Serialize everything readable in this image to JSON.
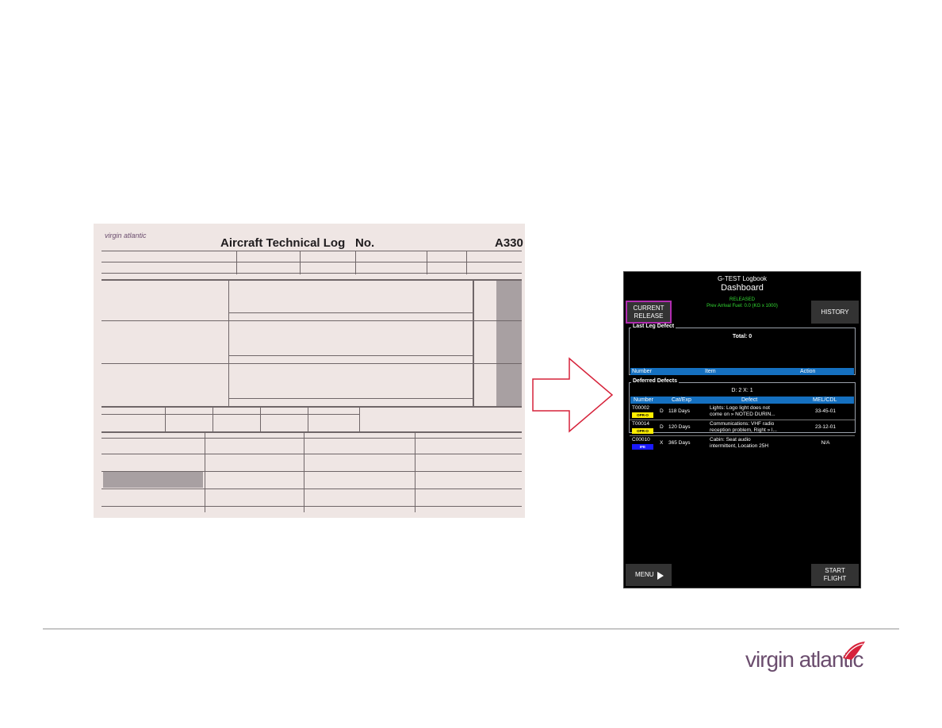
{
  "paper_form": {
    "brand": "virgin atlantic",
    "title": "Aircraft Technical Log",
    "no_label": "No.",
    "model": "A330"
  },
  "efb": {
    "title": "G-TEST Logbook",
    "subtitle": "Dashboard",
    "status": "RELEASED",
    "fuel": "Prev Arrival Fuel: 0.0 (KG x 1000)",
    "buttons": {
      "current_release": "CURRENT RELEASE",
      "history": "HISTORY",
      "menu": "MENU",
      "start_flight": "START FLIGHT"
    },
    "last_leg": {
      "title": "Last Leg Defect",
      "total": "Total: 0",
      "columns": [
        "Number",
        "Item",
        "Action"
      ]
    },
    "deferred": {
      "title": "Deferred Defects",
      "summary": "D: 2   X: 1",
      "columns": [
        "Number",
        "Cat/Exp",
        "Defect",
        "MEL/CDL"
      ],
      "rows": [
        {
          "number": "T00002",
          "badge": "OPR-O",
          "cat": "D",
          "exp": "118 Days",
          "defect1": "Lights: Logo light does not",
          "defect2": "come on » NOTED DURIN...",
          "mel": "33-45-01"
        },
        {
          "number": "T00014",
          "badge": "OPR-O",
          "cat": "D",
          "exp": "120 Days",
          "defect1": "Communications: VHF radio",
          "defect2": "reception problem, Right » l...",
          "mel": "23-12-01"
        },
        {
          "number": "C00010",
          "badge": "IFE",
          "cat": "X",
          "exp": "365 Days",
          "defect1": "Cabin: Seat audio",
          "defect2": "intermittent, Location 25H",
          "mel": "N/A"
        }
      ]
    }
  },
  "footer": {
    "logo": "virgin atlantic"
  },
  "colors": {
    "header_blue": "#1570c0",
    "opr_badge": "#ffee00",
    "ife_badge": "#1a1aff",
    "status_green": "#33dd33",
    "arrow_red": "#d6223a",
    "brand_purple": "#6b4d6e"
  }
}
